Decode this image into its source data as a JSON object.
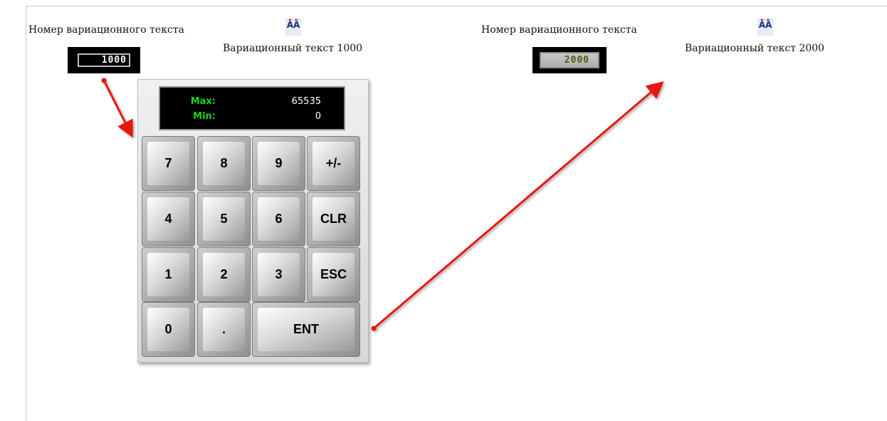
{
  "left_panel": {
    "label": "Номер вариационного текста",
    "value": "1000",
    "variable_text": "Вариационный текст 1000",
    "icon": "font-aa-icon"
  },
  "right_panel": {
    "label": "Номер вариационного текста",
    "value": "2000",
    "variable_text": "Вариационный текст 2000",
    "icon": "font-aa-icon"
  },
  "keypad": {
    "max_label": "Max:",
    "max_value": "65535",
    "min_label": "Min:",
    "min_value": "0",
    "keys": [
      "7",
      "8",
      "9",
      "+/-",
      "4",
      "5",
      "6",
      "CLR",
      "1",
      "2",
      "3",
      "ESC",
      "0",
      ".",
      "ENT"
    ]
  },
  "colors": {
    "arrow": "#e8130f",
    "display_label": "#19d319"
  }
}
